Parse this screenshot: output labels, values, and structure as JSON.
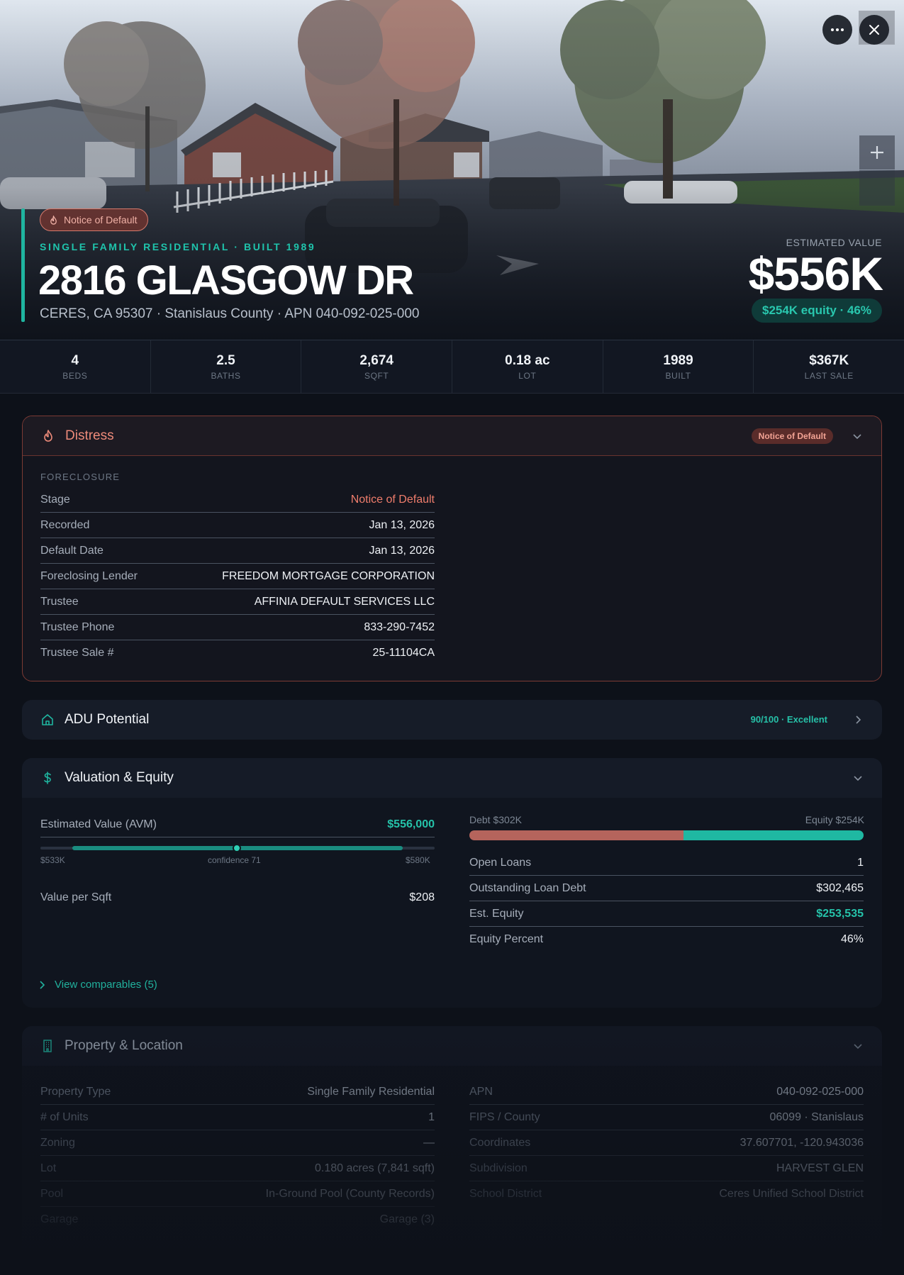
{
  "hero": {
    "badge": "Notice of Default",
    "subtitle": "SINGLE FAMILY RESIDENTIAL · BUILT 1989",
    "title": "2816 GLASGOW DR",
    "address": "CERES, CA 95307 · Stanislaus County · APN 040-092-025-000",
    "estimated_label": "ESTIMATED VALUE",
    "estimated_value": "$556K",
    "equity": "$254K equity · 46%"
  },
  "stats": [
    {
      "value": "4",
      "label": "BEDS"
    },
    {
      "value": "2.5",
      "label": "BATHS"
    },
    {
      "value": "2,674",
      "label": "SQFT"
    },
    {
      "value": "0.18 ac",
      "label": "LOT"
    },
    {
      "value": "1989",
      "label": "BUILT"
    },
    {
      "value": "$367K",
      "label": "LAST SALE"
    }
  ],
  "distress": {
    "title": "Distress",
    "badge": "Notice of Default",
    "section": "FORECLOSURE",
    "rows": [
      {
        "k": "Stage",
        "v": "Notice of Default"
      },
      {
        "k": "Recorded",
        "v": "Jan 13, 2026"
      },
      {
        "k": "Default Date",
        "v": "Jan 13, 2026"
      },
      {
        "k": "Foreclosing Lender",
        "v": "FREEDOM MORTGAGE CORPORATION"
      },
      {
        "k": "Trustee",
        "v": "AFFINIA DEFAULT SERVICES LLC"
      },
      {
        "k": "Trustee Phone",
        "v": "833-290-7452"
      },
      {
        "k": "Trustee Sale #",
        "v": "25-11104CA"
      }
    ]
  },
  "adu": {
    "title": "ADU Potential",
    "score": "90/100 · Excellent"
  },
  "valuation": {
    "title": "Valuation & Equity",
    "avm_label": "Estimated Value (AVM)",
    "avm_value": "$556,000",
    "range_low": "$533K",
    "range_high": "$580K",
    "confidence": "confidence 71",
    "per_sqft_label": "Value per Sqft",
    "per_sqft_value": "$208",
    "debt_label": "Debt $302K",
    "equity_label": "Equity $254K",
    "debt_fraction": 0.544,
    "rows": [
      {
        "k": "Open Loans",
        "v": "1"
      },
      {
        "k": "Outstanding Loan Debt",
        "v": "$302,465"
      },
      {
        "k": "Est. Equity",
        "v": "$253,535"
      },
      {
        "k": "Equity Percent",
        "v": "46%"
      }
    ],
    "comparables_link": "View comparables (5)"
  },
  "property": {
    "title": "Property & Location",
    "left": [
      {
        "k": "Property Type",
        "v": "Single Family Residential"
      },
      {
        "k": "# of Units",
        "v": "1"
      },
      {
        "k": "Zoning",
        "v": "—"
      },
      {
        "k": "Lot",
        "v": "0.180 acres (7,841 sqft)"
      },
      {
        "k": "Pool",
        "v": "In-Ground Pool (County Records)"
      },
      {
        "k": "Garage",
        "v": "Garage (3)"
      }
    ],
    "right": [
      {
        "k": "APN",
        "v": "040-092-025-000"
      },
      {
        "k": "FIPS / County",
        "v": "06099 · Stanislaus"
      },
      {
        "k": "Coordinates",
        "v": "37.607701, -120.943036"
      },
      {
        "k": "Subdivision",
        "v": "HARVEST GLEN"
      },
      {
        "k": "School District",
        "v": "Ceres Unified School District"
      }
    ]
  },
  "colors": {
    "accent_teal": "#1fb5a0",
    "distress_red": "#ef7d6c",
    "debt_bar": "#b5645c",
    "equity_bar": "#1fb8a2"
  }
}
